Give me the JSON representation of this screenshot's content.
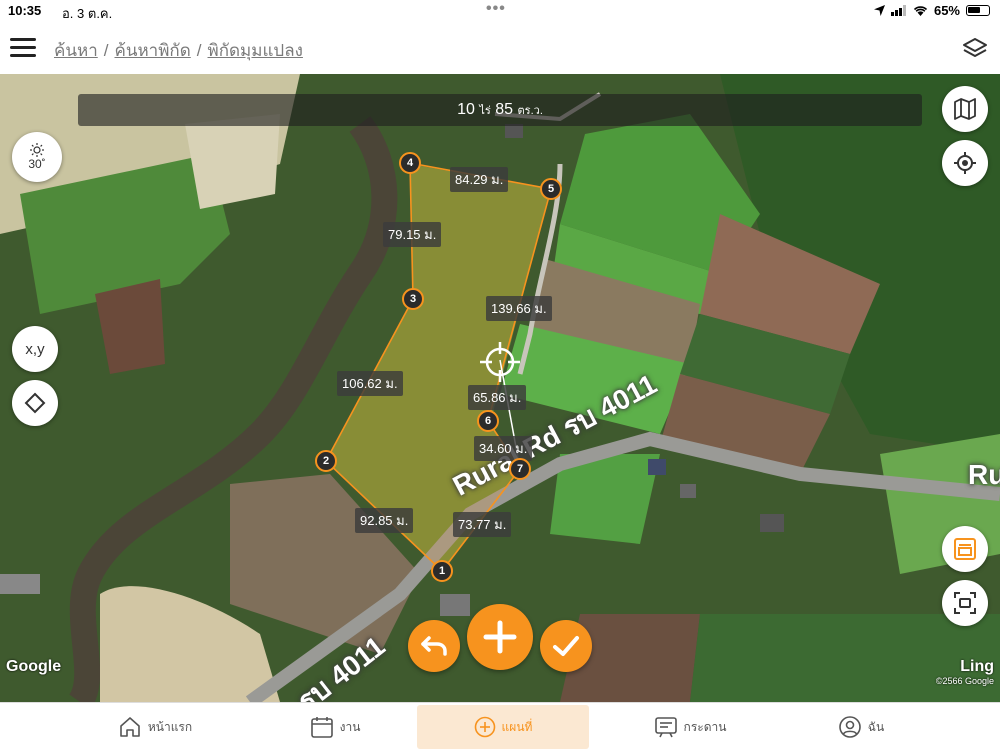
{
  "status_bar": {
    "time": "10:35",
    "date": "อ. 3 ต.ค.",
    "battery_percent": "65%",
    "battery_level": 0.65
  },
  "header": {
    "breadcrumb": [
      "ค้นหา",
      "ค้นหาพิกัด",
      "พิกัดมุมแปลง"
    ],
    "separator": "/"
  },
  "map": {
    "area": {
      "rai_value": "10",
      "rai_unit": "ไร่",
      "wa_value": "85",
      "wa_unit": "ตร.ว."
    },
    "sun_angle": "30˚",
    "xy_label": "x,y",
    "vertices": [
      "1",
      "2",
      "3",
      "4",
      "5",
      "6",
      "7"
    ],
    "segments": [
      {
        "id": "1-2",
        "label": "92.85 ม."
      },
      {
        "id": "2-3",
        "label": "106.62 ม."
      },
      {
        "id": "3-4",
        "label": "79.15 ม."
      },
      {
        "id": "4-5",
        "label": "84.29 ม."
      },
      {
        "id": "5-6",
        "label": "139.66 ม."
      },
      {
        "id": "6-7",
        "label": "34.60 ม."
      },
      {
        "id": "7-1",
        "label": "73.77 ม."
      },
      {
        "id": "center-6",
        "label": "65.86 ม."
      }
    ],
    "road_labels": [
      "Rural Rd รบ 4011",
      "รบ 4011",
      "Ru"
    ],
    "google_logo": "Google",
    "imagery_provider": "Ling",
    "copyright": "©2566 Google",
    "colors": {
      "accent": "#f7931e",
      "polygon_fill": "rgba(247,147,30,0.18)"
    }
  },
  "tab_bar": {
    "tabs": [
      {
        "label": "หน้าแรก",
        "icon": "home-icon",
        "active": false
      },
      {
        "label": "งาน",
        "icon": "calendar-icon",
        "active": false
      },
      {
        "label": "แผนที่",
        "icon": "plus-circle-icon",
        "active": true
      },
      {
        "label": "กระดาน",
        "icon": "board-icon",
        "active": false
      },
      {
        "label": "ฉัน",
        "icon": "user-icon",
        "active": false
      }
    ]
  }
}
